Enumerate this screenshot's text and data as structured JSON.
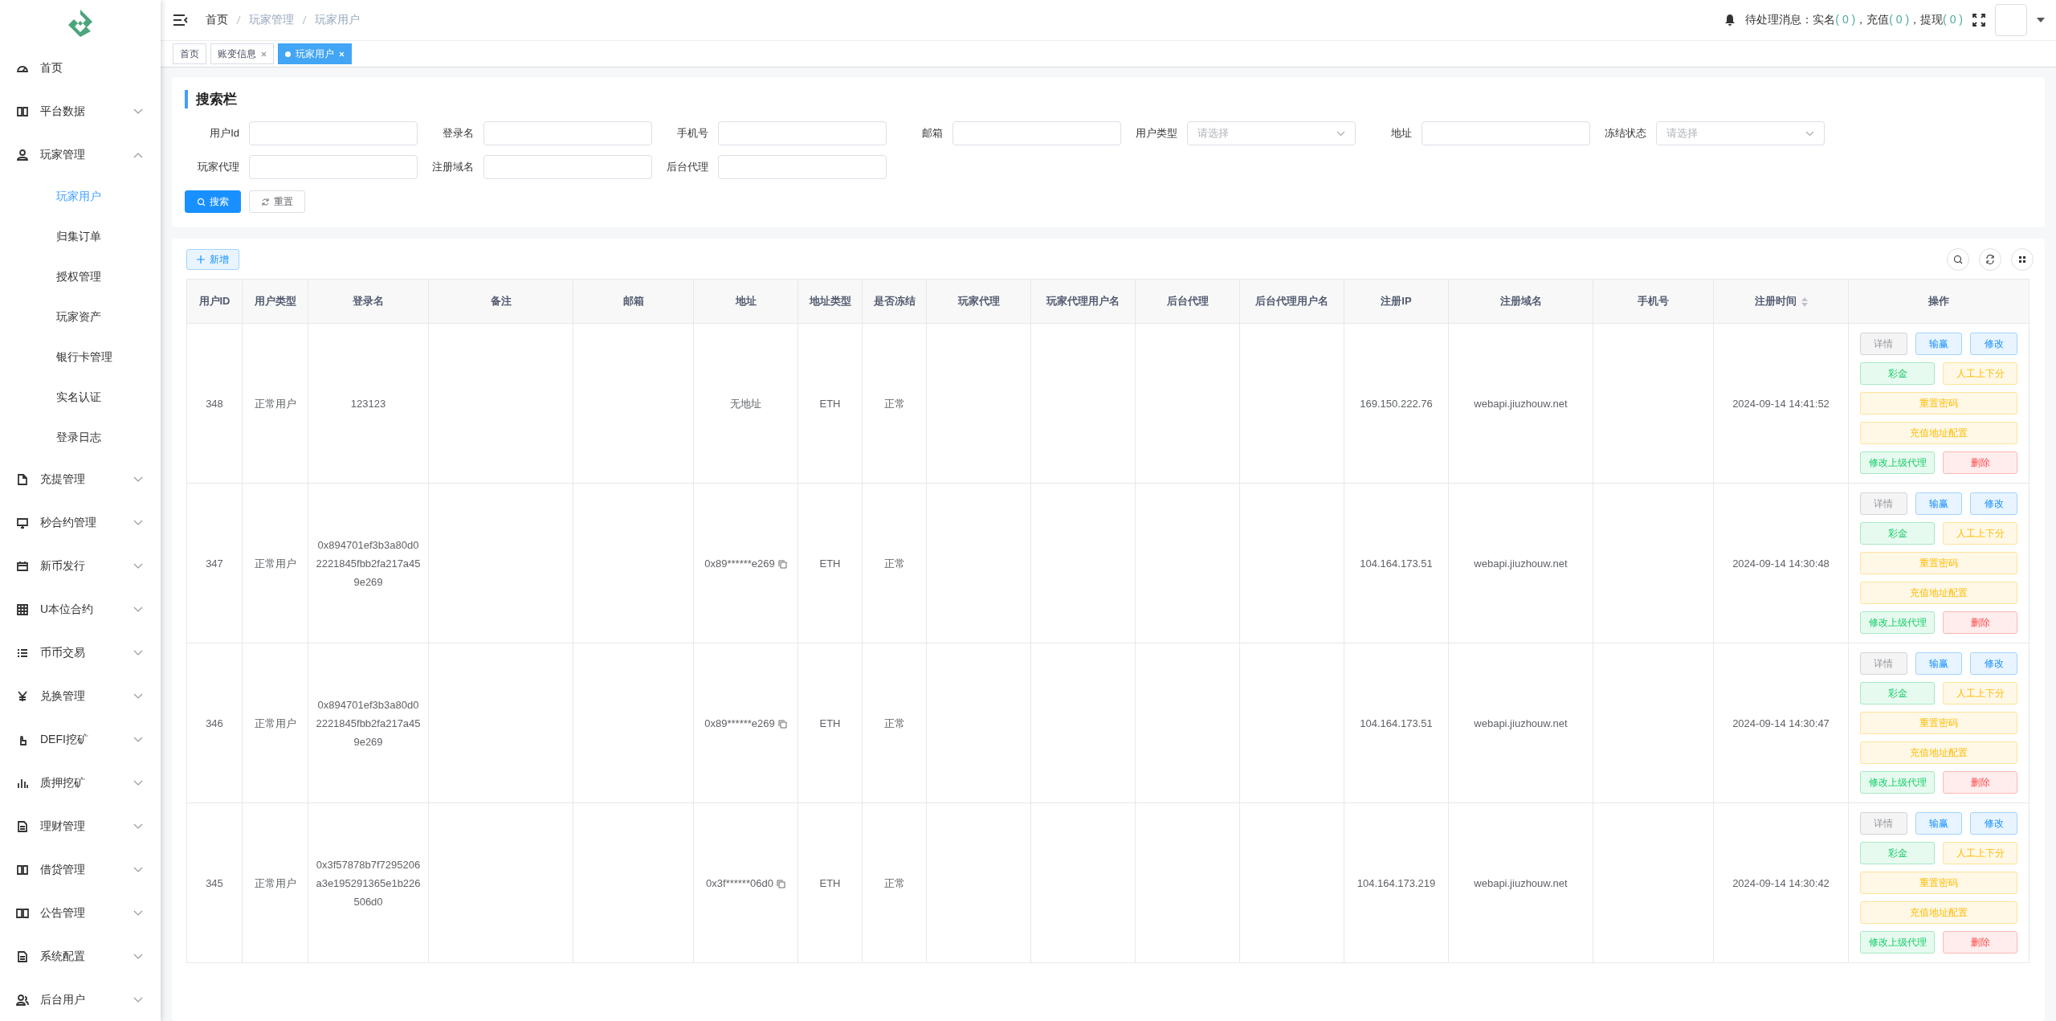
{
  "sidebar": {
    "items": [
      {
        "label": "首页"
      },
      {
        "label": "平台数据",
        "expanded": false
      },
      {
        "label": "玩家管理",
        "expanded": true,
        "children": [
          {
            "label": "玩家用户",
            "selected": true
          },
          {
            "label": "归集订单",
            "selected": false
          },
          {
            "label": "授权管理",
            "selected": false
          },
          {
            "label": "玩家资产",
            "selected": false
          },
          {
            "label": "银行卡管理",
            "selected": false
          },
          {
            "label": "实名认证",
            "selected": false
          },
          {
            "label": "登录日志",
            "selected": false
          }
        ]
      },
      {
        "label": "充提管理",
        "expanded": false
      },
      {
        "label": "秒合约管理",
        "expanded": false
      },
      {
        "label": "新币发行",
        "expanded": false
      },
      {
        "label": "U本位合约",
        "expanded": false
      },
      {
        "label": "币币交易",
        "expanded": false
      },
      {
        "label": "兑换管理",
        "expanded": false
      },
      {
        "label": "DEFI挖矿",
        "expanded": false
      },
      {
        "label": "质押挖矿",
        "expanded": false
      },
      {
        "label": "理财管理",
        "expanded": false
      },
      {
        "label": "借贷管理",
        "expanded": false
      },
      {
        "label": "公告管理",
        "expanded": false
      },
      {
        "label": "系统配置",
        "expanded": false
      },
      {
        "label": "后台用户",
        "expanded": false
      }
    ]
  },
  "breadcrumb": [
    "首页",
    "玩家管理",
    "玩家用户"
  ],
  "notice": {
    "label": "待处理消息：实名",
    "count_1": "( 0 )",
    "label_2": "，充值",
    "count_2": "( 0 )",
    "label_3": "，提现",
    "count_3": "( 0 )"
  },
  "tags": [
    {
      "label": "首页",
      "selected": false,
      "closable": false
    },
    {
      "label": "账变信息",
      "selected": false,
      "closable": true
    },
    {
      "label": "玩家用户",
      "selected": true,
      "closable": true
    }
  ],
  "search": {
    "title": "搜索栏",
    "fields": [
      {
        "label": "用户Id",
        "kind": "input"
      },
      {
        "label": "登录名",
        "kind": "input"
      },
      {
        "label": "手机号",
        "kind": "input"
      },
      {
        "label": "邮箱",
        "kind": "input"
      },
      {
        "label": "用户类型",
        "kind": "select",
        "placeholder": "请选择"
      },
      {
        "label": "地址",
        "kind": "input"
      },
      {
        "label": "冻结状态",
        "kind": "select",
        "placeholder": "请选择"
      },
      {
        "label": "玩家代理",
        "kind": "input"
      },
      {
        "label": "注册域名",
        "kind": "input"
      },
      {
        "label": "后台代理",
        "kind": "input"
      }
    ],
    "buttons": [
      {
        "label": "搜索",
        "kind": "primary"
      },
      {
        "label": "重置",
        "kind": "default"
      }
    ]
  },
  "toolbar": {
    "add_button": "新增"
  },
  "table": {
    "columns": [
      {
        "title": "用户ID"
      },
      {
        "title": "用户类型"
      },
      {
        "title": "登录名"
      },
      {
        "title": "备注"
      },
      {
        "title": "邮箱"
      },
      {
        "title": "地址"
      },
      {
        "title": "地址类型"
      },
      {
        "title": "是否冻结"
      },
      {
        "title": "玩家代理"
      },
      {
        "title": "玩家代理用户名"
      },
      {
        "title": "后台代理"
      },
      {
        "title": "后台代理用户名"
      },
      {
        "title": "注册IP"
      },
      {
        "title": "注册域名"
      },
      {
        "title": "手机号"
      },
      {
        "title": "注册时间",
        "sortable": true
      },
      {
        "title": "操作"
      }
    ],
    "rows": [
      {
        "user_id": "348",
        "user_type": "正常用户",
        "login_name": "123123",
        "address": "无地址",
        "address_copyable": false,
        "address_type": "ETH",
        "frozen_status": "正常",
        "register_ip": "169.150.222.76",
        "register_domain": "webapi.jiuzhouw.net",
        "register_time": "2024-09-14 14:41:52",
        "actions": [
          [
            {
              "label": "详情",
              "kind": "info"
            },
            {
              "label": "输赢",
              "kind": "primary"
            },
            {
              "label": "修改",
              "kind": "primary"
            }
          ],
          [
            {
              "label": "彩金",
              "kind": "success"
            },
            {
              "label": "人工上下分",
              "kind": "warning"
            }
          ],
          [
            {
              "label": "重置密码",
              "kind": "warning"
            }
          ],
          [
            {
              "label": "充值地址配置",
              "kind": "warning"
            }
          ],
          [
            {
              "label": "修改上级代理",
              "kind": "success"
            },
            {
              "label": "删除",
              "kind": "danger"
            }
          ]
        ]
      },
      {
        "user_id": "347",
        "user_type": "正常用户",
        "login_name": "0x894701ef3b3a80d02221845fbb2fa217a459e269",
        "address": "0x89******e269",
        "address_copyable": true,
        "address_type": "ETH",
        "frozen_status": "正常",
        "register_ip": "104.164.173.51",
        "register_domain": "webapi.jiuzhouw.net",
        "register_time": "2024-09-14 14:30:48",
        "actions": [
          [
            {
              "label": "详情",
              "kind": "info"
            },
            {
              "label": "输赢",
              "kind": "primary"
            },
            {
              "label": "修改",
              "kind": "primary"
            }
          ],
          [
            {
              "label": "彩金",
              "kind": "success"
            },
            {
              "label": "人工上下分",
              "kind": "warning"
            }
          ],
          [
            {
              "label": "重置密码",
              "kind": "warning"
            }
          ],
          [
            {
              "label": "充值地址配置",
              "kind": "warning"
            }
          ],
          [
            {
              "label": "修改上级代理",
              "kind": "success"
            },
            {
              "label": "删除",
              "kind": "danger"
            }
          ]
        ]
      },
      {
        "user_id": "346",
        "user_type": "正常用户",
        "login_name": "0x894701ef3b3a80d02221845fbb2fa217a459e269",
        "address": "0x89******e269",
        "address_copyable": true,
        "address_type": "ETH",
        "frozen_status": "正常",
        "register_ip": "104.164.173.51",
        "register_domain": "webapi.jiuzhouw.net",
        "register_time": "2024-09-14 14:30:47",
        "actions": [
          [
            {
              "label": "详情",
              "kind": "info"
            },
            {
              "label": "输赢",
              "kind": "primary"
            },
            {
              "label": "修改",
              "kind": "primary"
            }
          ],
          [
            {
              "label": "彩金",
              "kind": "success"
            },
            {
              "label": "人工上下分",
              "kind": "warning"
            }
          ],
          [
            {
              "label": "重置密码",
              "kind": "warning"
            }
          ],
          [
            {
              "label": "充值地址配置",
              "kind": "warning"
            }
          ],
          [
            {
              "label": "修改上级代理",
              "kind": "success"
            },
            {
              "label": "删除",
              "kind": "danger"
            }
          ]
        ]
      },
      {
        "user_id": "345",
        "user_type": "正常用户",
        "login_name": "0x3f57878b7f7295206a3e195291365e1b226506d0",
        "address": "0x3f******06d0",
        "address_copyable": true,
        "address_type": "ETH",
        "frozen_status": "正常",
        "register_ip": "104.164.173.219",
        "register_domain": "webapi.jiuzhouw.net",
        "register_time": "2024-09-14 14:30:42",
        "actions": [
          [
            {
              "label": "详情",
              "kind": "info"
            },
            {
              "label": "输赢",
              "kind": "primary"
            },
            {
              "label": "修改",
              "kind": "primary"
            }
          ],
          [
            {
              "label": "彩金",
              "kind": "success"
            },
            {
              "label": "人工上下分",
              "kind": "warning"
            }
          ],
          [
            {
              "label": "重置密码",
              "kind": "warning"
            }
          ],
          [
            {
              "label": "充值地址配置",
              "kind": "warning"
            }
          ],
          [
            {
              "label": "修改上级代理",
              "kind": "success"
            },
            {
              "label": "删除",
              "kind": "danger"
            }
          ]
        ]
      }
    ]
  }
}
